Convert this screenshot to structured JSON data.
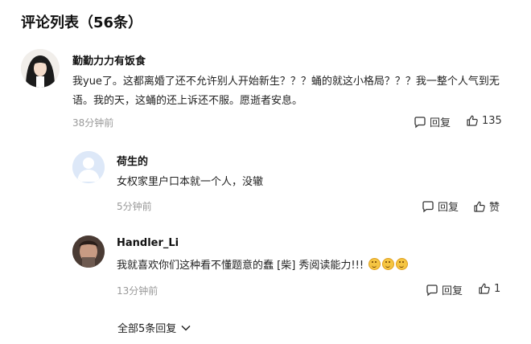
{
  "header": {
    "title": "评论列表（56条）"
  },
  "comments": [
    {
      "author": "勤勤力力有饭食",
      "text": "我yue了。这都离婚了还不允许别人开始新生？？？蛹的就这小格局？？？我一整个人气到无语。我的天，这蛹的还上诉还不服。愿逝者安息。",
      "time": "38分钟前",
      "reply_label": "回复",
      "like_count": "135"
    },
    {
      "author": "荷生的",
      "text": "女权家里户口本就一个人，没辙",
      "time": "5分钟前",
      "reply_label": "回复",
      "like_count": "赞"
    },
    {
      "author": "Handler_Li",
      "text": "我就喜欢你们这种看不懂题意的蠢 [柴] 秀阅读能力!!!",
      "time": "13分钟前",
      "reply_label": "回复",
      "like_count": "1"
    }
  ],
  "replies_toggle": {
    "label": "全部5条回复"
  },
  "icons": {
    "reply": "comment-bubble-icon",
    "like": "thumbs-up-icon",
    "expand": "chevron-down-icon"
  }
}
